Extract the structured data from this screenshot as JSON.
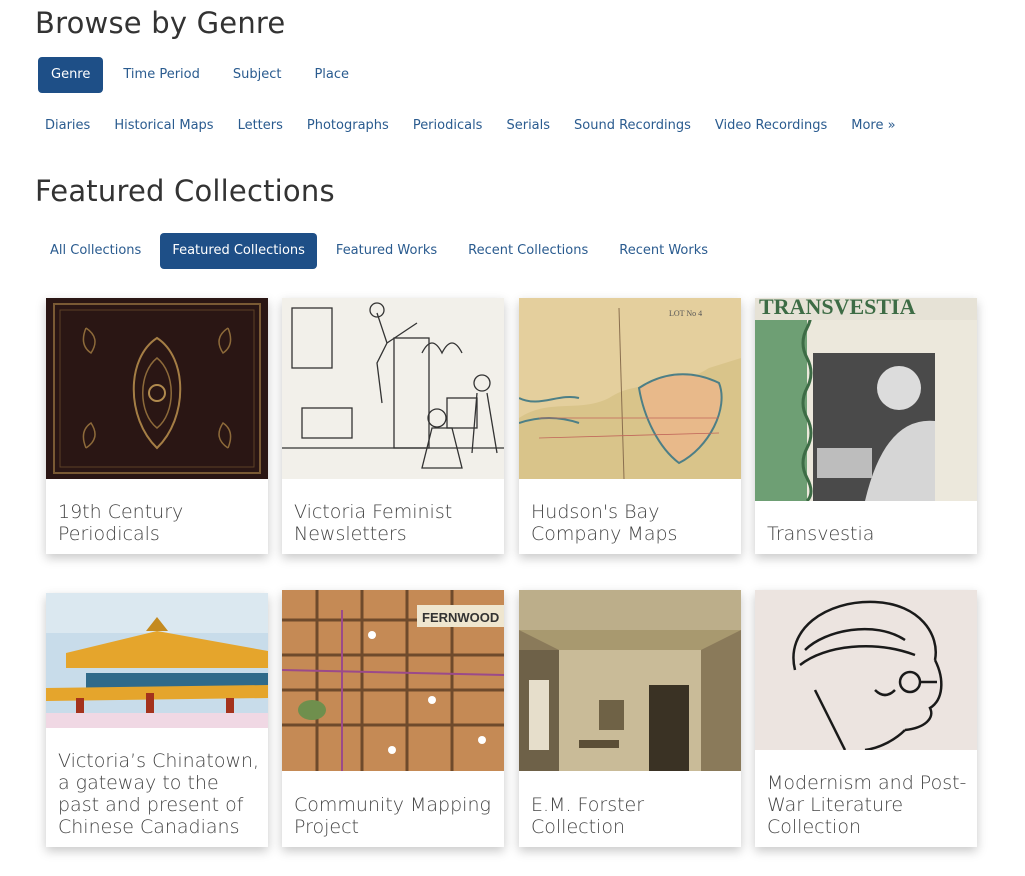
{
  "browse": {
    "heading": "Browse by Genre",
    "tabs": [
      {
        "label": "Genre",
        "active": true
      },
      {
        "label": "Time Period",
        "active": false
      },
      {
        "label": "Subject",
        "active": false
      },
      {
        "label": "Place",
        "active": false
      }
    ],
    "genres": [
      "Diaries",
      "Historical Maps",
      "Letters",
      "Photographs",
      "Periodicals",
      "Serials",
      "Sound Recordings",
      "Video Recordings",
      "More »"
    ]
  },
  "featured": {
    "heading": "Featured Collections",
    "tabs": [
      {
        "label": "All Collections",
        "active": false
      },
      {
        "label": "Featured Collections",
        "active": true
      },
      {
        "label": "Featured Works",
        "active": false
      },
      {
        "label": "Recent Collections",
        "active": false
      },
      {
        "label": "Recent Works",
        "active": false
      }
    ],
    "cards": [
      {
        "title": "19th Century Periodicals",
        "image": "ornate-book-cover"
      },
      {
        "title": "Victoria Feminist Newsletters",
        "image": "feminist-cartoon"
      },
      {
        "title": "Hudson's Bay Company Maps",
        "image": "hand-drawn-map"
      },
      {
        "title": "Transvestia",
        "image": "magazine-portrait"
      },
      {
        "title": "Victoria’s Chinatown, a gateway to the past and present of Chinese Canadians",
        "image": "chinatown-gate"
      },
      {
        "title": "Community Mapping Project",
        "image": "community-map"
      },
      {
        "title": "E.M. Forster Collection",
        "image": "ornate-room"
      },
      {
        "title": "Modernism and Post-War Literature Collection",
        "image": "profile-sketch"
      }
    ]
  }
}
